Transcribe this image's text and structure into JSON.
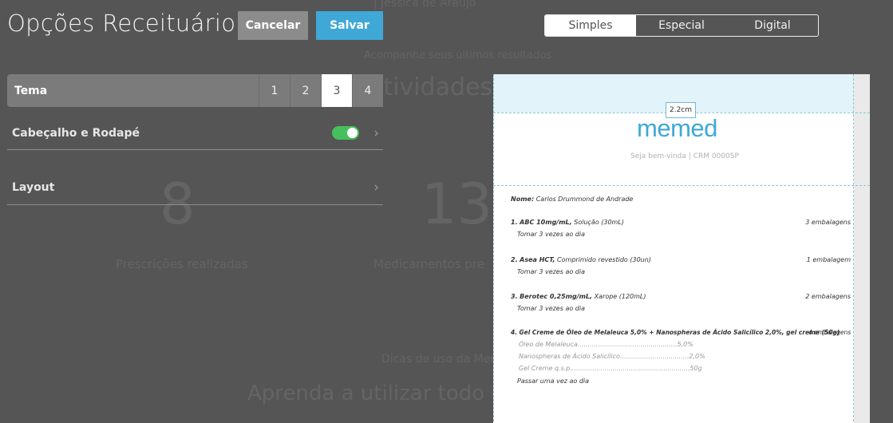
{
  "background": {
    "top_text": "| Jessica de Araujo",
    "subtitle": "Acompanhe seus últimos resultados",
    "heading": "atividades",
    "stat1_value": "8",
    "stat1_label": "Prescrições realizadas",
    "stat2_value": "13",
    "stat2_label": "Medicamentos pre",
    "middle_text": "Dicas de uso da Memed",
    "learn_text": "Aprenda a utilizar todo o"
  },
  "header": {
    "title": "Opções Receituário",
    "cancel_label": "Cancelar",
    "save_label": "Salvar"
  },
  "type_tabs": {
    "items": [
      "Simples",
      "Especial",
      "Digital"
    ],
    "active": "Simples"
  },
  "options": {
    "theme_label": "Tema",
    "theme_options": [
      "1",
      "2",
      "3",
      "4"
    ],
    "theme_selected": "3",
    "header_footer_label": "Cabeçalho e Rodapé",
    "header_footer_enabled": true,
    "layout_label": "Layout"
  },
  "preview": {
    "header_margin": "2.2cm",
    "logo": "memed",
    "welcome": "Seja bem-vinda | CRM 0000SP",
    "patient_label": "Nome:",
    "patient_name": "Carlos Drummond de Andrade",
    "items": [
      {
        "number": "1.",
        "name": "ABC 10mg/mL,",
        "form": "Solução (30mL)",
        "qty": "3 embalagens",
        "instr": "Tomar 3 vezes ao dia"
      },
      {
        "number": "2.",
        "name": "Asea HCT,",
        "form": "Comprimido revestido (30un)",
        "qty": "1 embalagem",
        "instr": "Tomar 3 vezes ao dia"
      },
      {
        "number": "3.",
        "name": "Berotec 0,25mg/mL,",
        "form": "Xarope (120mL)",
        "qty": "2 embalagens",
        "instr": "Tomar 3 vezes ao dia"
      },
      {
        "number": "4.",
        "name": "Gel Creme de Óleo de Melaleuca 5,0% + Nanospheras de Ácido Salicílico 2,0%, gel creme (50g)",
        "form": "",
        "qty": "4 embalagens",
        "instr": "Passar uma vez ao dia"
      }
    ],
    "compounds": [
      "Óleo de Melaleuca.................................................5,0%",
      "Nanospheras de Ácido Salicílico..................................2,0%",
      "Gel Creme q.s.p...........................................................50g"
    ]
  },
  "colors": {
    "accent": "#3fa8d6",
    "toggle_on": "#45c05c",
    "overlay": "#555555"
  }
}
